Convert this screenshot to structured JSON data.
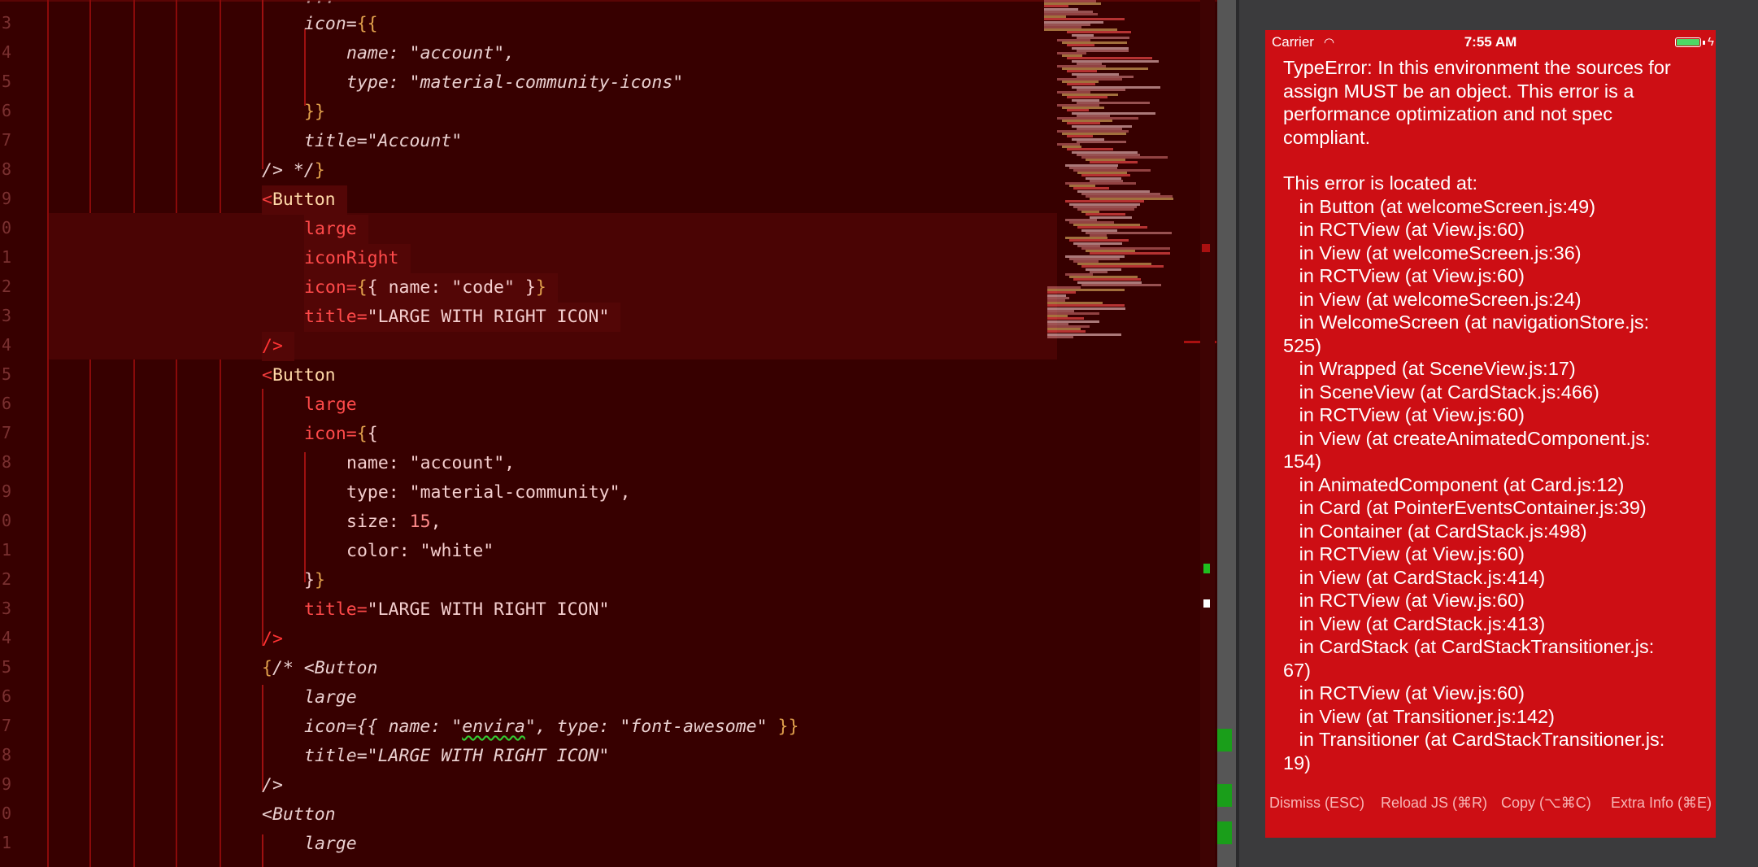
{
  "editor": {
    "line_numbers": [
      "3",
      "4",
      "5",
      "6",
      "7",
      "8",
      "9",
      "0",
      "1",
      "2",
      "3",
      "4",
      "5",
      "6",
      "7",
      "8",
      "9",
      "0",
      "1",
      "2",
      "3",
      "4",
      "5",
      "6",
      "7",
      "8",
      "9",
      "0",
      "1"
    ]
  },
  "simulator": {
    "carrier": "Carrier",
    "time": "7:55 AM",
    "error_head": "TypeError: In this environment the sources for assign MUST be an object. This error is a performance optimization and not spec compliant.",
    "error_location_label": "This error is located at:",
    "stack": [
      "in Button (at welcomeScreen.js:49)",
      "in RCTView (at View.js:60)",
      "in View (at welcomeScreen.js:36)",
      "in RCTView (at View.js:60)",
      "in View (at welcomeScreen.js:24)",
      "in WelcomeScreen (at navigationStore.js:\n525)",
      "in Wrapped (at SceneView.js:17)",
      "in SceneView (at CardStack.js:466)",
      "in RCTView (at View.js:60)",
      "in View (at createAnimatedComponent.js:\n154)",
      "in AnimatedComponent (at Card.js:12)",
      "in Card (at PointerEventsContainer.js:39)",
      "in Container (at CardStack.js:498)",
      "in RCTView (at View.js:60)",
      "in View (at CardStack.js:414)",
      "in RCTView (at View.js:60)",
      "in View (at CardStack.js:413)",
      "in CardStack (at CardStackTransitioner.js:\n67)",
      "in RCTView (at View.js:60)",
      "in View (at Transitioner.js:142)",
      "in Transitioner (at CardStackTransitioner.js:\n19)"
    ],
    "buttons": {
      "dismiss": "Dismiss (ESC)",
      "reload": "Reload JS (⌘R)",
      "copy": "Copy (⌥⌘C)",
      "extra": "Extra Info (⌘E)"
    }
  },
  "code": {
    "l0": "title=\"Account\"",
    "l1": "name: \"account\",",
    "l2": "type: \"material-community-icons\"",
    "l3": "title=\"Account\"",
    "l4": "/> */",
    "tag_button": "Button",
    "large": "large",
    "iconRight": "iconRight",
    "icon_eq": "icon=",
    "code_name": " name: \"code\" ",
    "title_eq": "title=",
    "large_right": "\"LARGE WITH RIGHT ICON\"",
    "self_close": "/>",
    "name_account": "name: \"account\",",
    "type_mc": "type: \"material-community\",",
    "size_key": "size: ",
    "size_val": "15",
    "comma": ",",
    "color_key": "color: \"white\"",
    "comment_open": "/* <Button",
    "envira_pre": " name: \"",
    "envira": "envira",
    "envira_post": "\", type: \"font-awesome\" ",
    "lt": "<",
    "icon_open": "icon={{",
    "brace_close": "}}",
    "brace_close_one": "}",
    "brace_open": "{{",
    "brace_close_two": "}}",
    "brace_lbrace": "{",
    "title_italic": "title=\"LARGE WITH RIGHT ICON\"",
    "large_italic": "large",
    "icon_eq_italic": "icon=",
    "self_close_italic": "/>",
    "button_italic": "<Button",
    "top_cut": "..."
  }
}
